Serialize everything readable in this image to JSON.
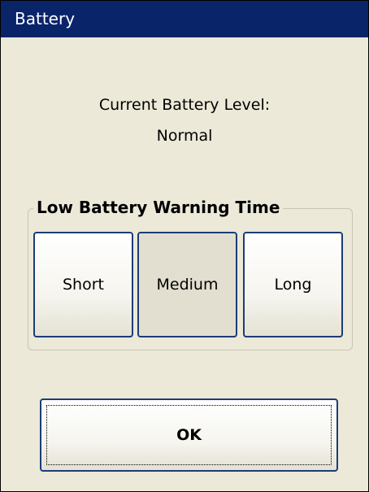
{
  "window": {
    "title": "Battery"
  },
  "battery": {
    "level_label": "Current Battery Level:",
    "level_value": "Normal"
  },
  "warning_group": {
    "legend": "Low Battery Warning Time",
    "options": [
      {
        "label": "Short",
        "selected": false
      },
      {
        "label": "Medium",
        "selected": true
      },
      {
        "label": "Long",
        "selected": false
      }
    ]
  },
  "actions": {
    "ok_label": "OK"
  },
  "colors": {
    "titlebar": "#0a246a",
    "background": "#ece9d8",
    "button_border": "#1c3c78"
  }
}
